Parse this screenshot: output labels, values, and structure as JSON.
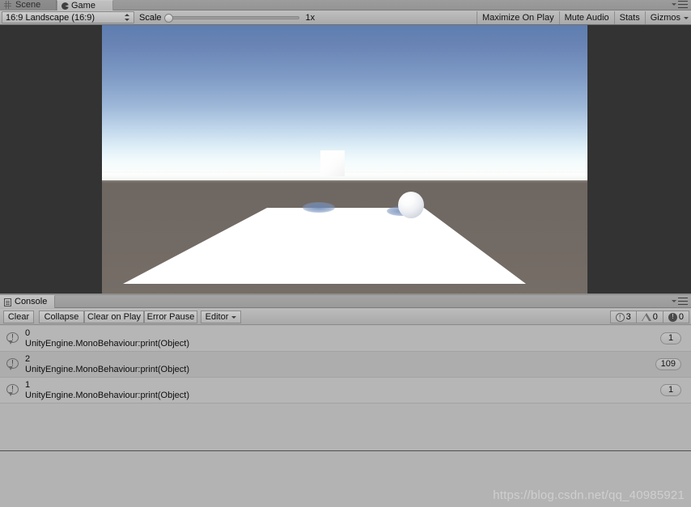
{
  "window": {
    "tabs": [
      {
        "label": "Scene",
        "icon": "grid-icon",
        "active": false
      },
      {
        "label": "Game",
        "icon": "pacman-icon",
        "active": true
      }
    ],
    "menu_icon": "hamburger-menu-icon"
  },
  "game_toolbar": {
    "aspect": {
      "value": "16:9 Landscape (16:9)",
      "icon": "updown-arrows-icon"
    },
    "scale": {
      "label": "Scale",
      "value": "1x",
      "slider_position": 0
    },
    "buttons": [
      {
        "label": "Maximize On Play"
      },
      {
        "label": "Mute Audio"
      },
      {
        "label": "Stats"
      },
      {
        "label": "Gizmos",
        "has_caret": true
      }
    ]
  },
  "game_view": {
    "sky_top_color": "#5e7eb0",
    "sky_horizon_color": "#f3fbfd",
    "ground_color": "#716963",
    "letterbox_color": "#333333",
    "objects": [
      {
        "name": "cube",
        "color": "#ffffff"
      },
      {
        "name": "sphere",
        "color": "#f2f3f6"
      },
      {
        "name": "plane",
        "color": "#ffffff"
      },
      {
        "name": "shadow",
        "color": "#6c88b6"
      }
    ]
  },
  "console": {
    "tab": {
      "label": "Console",
      "icon": "document-icon"
    },
    "menu_icon": "hamburger-menu-icon",
    "toolbar": {
      "clear": "Clear",
      "collapse": "Collapse",
      "clear_on_play": "Clear on Play",
      "error_pause": "Error Pause",
      "editor": "Editor"
    },
    "counters": {
      "info": "3",
      "warning": "0",
      "error": "0"
    },
    "entries": [
      {
        "type": "info",
        "message": "0",
        "stack": "UnityEngine.MonoBehaviour:print(Object)",
        "count": "1"
      },
      {
        "type": "info",
        "message": "2",
        "stack": "UnityEngine.MonoBehaviour:print(Object)",
        "count": "109"
      },
      {
        "type": "info",
        "message": "1",
        "stack": "UnityEngine.MonoBehaviour:print(Object)",
        "count": "1"
      }
    ]
  },
  "watermark": "https://blog.csdn.net/qq_40985921"
}
